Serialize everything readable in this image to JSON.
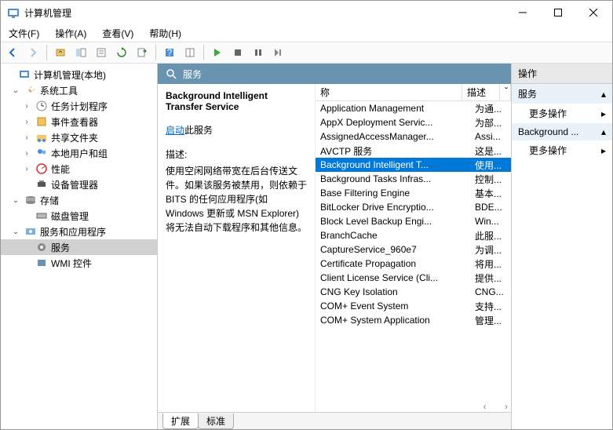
{
  "window": {
    "title": "计算机管理"
  },
  "menus": {
    "file": "文件(F)",
    "action": "操作(A)",
    "view": "查看(V)",
    "help": "帮助(H)"
  },
  "tree": {
    "root": "计算机管理(本地)",
    "sys_tools": "系统工具",
    "task_sched": "任务计划程序",
    "event_viewer": "事件查看器",
    "shared": "共享文件夹",
    "local_users": "本地用户和组",
    "perf": "性能",
    "devmgr": "设备管理器",
    "storage": "存储",
    "diskmgr": "磁盘管理",
    "svc_apps": "服务和应用程序",
    "services": "服务",
    "wmi": "WMI 控件"
  },
  "mid": {
    "header": "服务",
    "selected_name": "Background Intelligent Transfer Service",
    "start_link": "启动",
    "start_suffix": "此服务",
    "desc_label": "描述:",
    "desc_text": "使用空闲网络带宽在后台传送文件。如果该服务被禁用，则依赖于 BITS 的任何应用程序(如 Windows 更新或 MSN Explorer)将无法自动下载程序和其他信息。",
    "col_name": "称",
    "col_desc": "描述",
    "tabs": {
      "ext": "扩展",
      "std": "标准"
    }
  },
  "services": [
    {
      "name": "Application Management",
      "desc": "为通...",
      "sel": false
    },
    {
      "name": "AppX Deployment Servic...",
      "desc": "为部...",
      "sel": false
    },
    {
      "name": "AssignedAccessManager...",
      "desc": "Assi...",
      "sel": false
    },
    {
      "name": "AVCTP 服务",
      "desc": "这是...",
      "sel": false
    },
    {
      "name": "Background Intelligent T...",
      "desc": "使用...",
      "sel": true
    },
    {
      "name": "Background Tasks Infras...",
      "desc": "控制...",
      "sel": false
    },
    {
      "name": "Base Filtering Engine",
      "desc": "基本...",
      "sel": false
    },
    {
      "name": "BitLocker Drive Encryptio...",
      "desc": "BDE...",
      "sel": false
    },
    {
      "name": "Block Level Backup Engi...",
      "desc": "Win...",
      "sel": false
    },
    {
      "name": "BranchCache",
      "desc": "此服...",
      "sel": false
    },
    {
      "name": "CaptureService_960e7",
      "desc": "为调...",
      "sel": false
    },
    {
      "name": "Certificate Propagation",
      "desc": "将用...",
      "sel": false
    },
    {
      "name": "Client License Service (Cli...",
      "desc": "提供...",
      "sel": false
    },
    {
      "name": "CNG Key Isolation",
      "desc": "CNG...",
      "sel": false
    },
    {
      "name": "COM+ Event System",
      "desc": "支持...",
      "sel": false
    },
    {
      "name": "COM+ System Application",
      "desc": "管理...",
      "sel": false
    }
  ],
  "actions": {
    "panel": "操作",
    "group1": "服务",
    "more": "更多操作",
    "group2": "Background ..."
  }
}
